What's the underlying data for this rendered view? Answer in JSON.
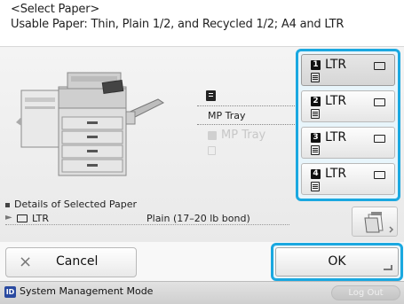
{
  "header": {
    "title": "<Select Paper>",
    "usable": "Usable Paper: Thin, Plain 1/2, and Recycled 1/2; A4 and LTR"
  },
  "middle": {
    "mp_tray": "MP Tray",
    "mp_tray_dim": "MP Tray"
  },
  "drawers": [
    {
      "num": "1",
      "label": "LTR"
    },
    {
      "num": "2",
      "label": "LTR"
    },
    {
      "num": "3",
      "label": "LTR"
    },
    {
      "num": "4",
      "label": "LTR"
    }
  ],
  "details": {
    "title": "Details of Selected Paper",
    "arrow": "►",
    "size": "LTR",
    "type": "Plain (17–20 lb bond)"
  },
  "buttons": {
    "cancel_x": "×",
    "cancel": "Cancel",
    "ok": "OK"
  },
  "status": {
    "badge": "ID",
    "mode": "System Management Mode",
    "logout": "Log Out"
  },
  "colors": {
    "accent": "#1aa8e0"
  }
}
